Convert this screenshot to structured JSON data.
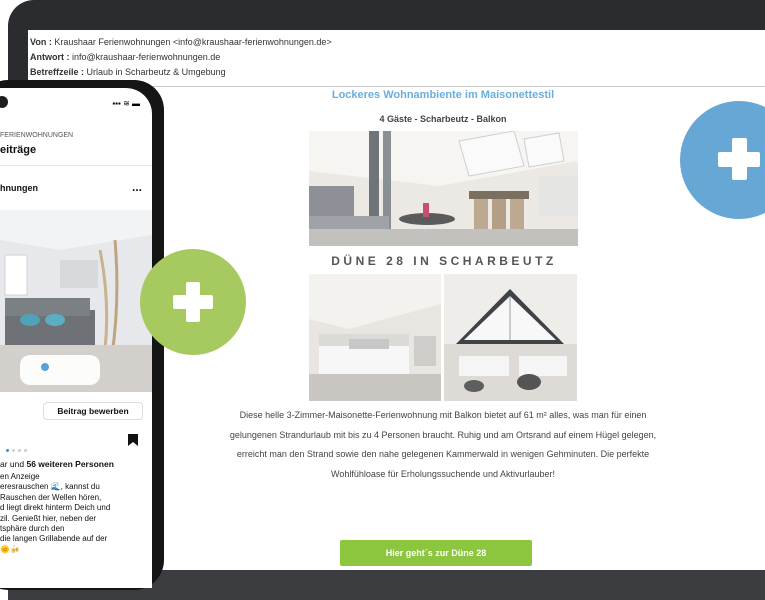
{
  "email": {
    "from_label": "Von :",
    "from_value": "Kraushaar Ferienwohnungen <info@kraushaar-ferienwohnungen.de>",
    "reply_label": "Antwort :",
    "reply_value": "info@kraushaar-ferienwohnungen.de",
    "subject_label": "Betreffzeile :",
    "subject_value": "Urlaub in Scharbeutz & Umgebung",
    "title": "Lockeres Wohnambiente im Maisonettestil",
    "subtitle": "4 Gäste - Scharbeutz - Balkon",
    "banner": "DÜNE 28 IN SCHARBEUTZ",
    "description": "Diese helle 3-Zimmer-Maisonette-Ferienwohnung mit Balkon bietet auf 61 m² alles, was man für einen gelungenen Strandurlaub mit bis zu 4 Personen braucht. Ruhig und am Ortsrand auf einem Hügel gelegen, erreicht man den Strand sowie den nahe gelegenen Kammerwald in wenigen Gehminuten. Die perfekte Wohlfühloase für Erholungssuchende und Aktivurlauber!",
    "cta": "Hier geht´s zur Düne 28"
  },
  "phone": {
    "page_name": "FERIENWOHNUNGEN",
    "page_title": "eiträge",
    "post_author": "hnungen",
    "more": "...",
    "promote_button": "Beitrag bewerben",
    "likes_prefix": "ar und",
    "likes_bold": "56 weiteren Personen",
    "caption": "en Anzeige\neresrauschen 🌊, kannst du\nRauschen der Wellen hören,\nd liegt direkt hinterm Deich und\nzil. Genießt hier, neben der\ntsphäre durch den\ndie langen Grillabende auf der\n🌞🍻"
  },
  "icons": {
    "green_circle": "plus-icon",
    "blue_circle": "plus-icon"
  },
  "colors": {
    "accent_green": "#8cc63f",
    "circle_green": "#a6ca60",
    "circle_blue": "#66a7d6",
    "title_blue": "#6aaedd"
  }
}
